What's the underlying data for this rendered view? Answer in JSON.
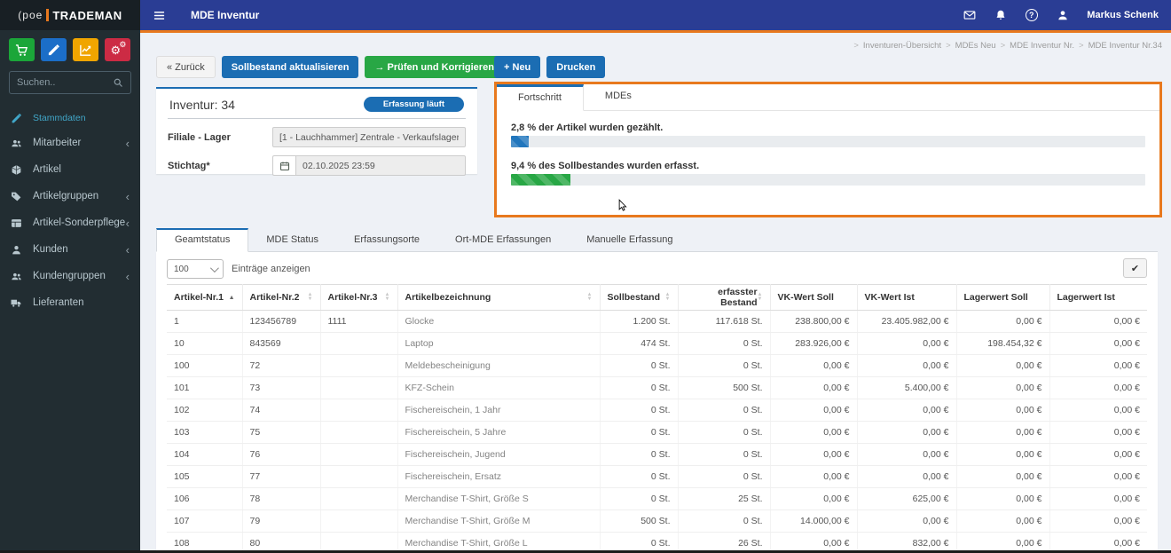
{
  "brand": {
    "mark": "(poe",
    "name": "TRADEMAN"
  },
  "navbar": {
    "title": "MDE Inventur",
    "user": "Markus Schenk"
  },
  "breadcrumb": [
    "Inventuren-Übersicht",
    "MDEs Neu",
    "MDE Inventur Nr.",
    "MDE Inventur Nr.34"
  ],
  "sidebar": {
    "search_placeholder": "Suchen..",
    "quick_buttons": [
      {
        "icon": "cart-icon",
        "color": "#1ba639"
      },
      {
        "icon": "pencil-icon",
        "color": "#1b6ec8"
      },
      {
        "icon": "chart-icon",
        "color": "#f0a500"
      },
      {
        "icon": "cogs-icon",
        "color": "#cc2b44"
      }
    ],
    "items": [
      {
        "label": "Stammdaten",
        "icon": "pencil-icon",
        "active": true,
        "small": true,
        "chevron": false
      },
      {
        "label": "Mitarbeiter",
        "icon": "users-icon",
        "chevron": true
      },
      {
        "label": "Artikel",
        "icon": "product-icon",
        "chevron": false
      },
      {
        "label": "Artikelgruppen",
        "icon": "tags-icon",
        "chevron": true
      },
      {
        "label": "Artikel-Sonderpflege",
        "icon": "table-icon",
        "chevron": true
      },
      {
        "label": "Kunden",
        "icon": "user-icon",
        "chevron": true
      },
      {
        "label": "Kundengruppen",
        "icon": "users-icon",
        "chevron": true
      },
      {
        "label": "Lieferanten",
        "icon": "truck-icon",
        "chevron": false
      }
    ]
  },
  "actions": {
    "back": "« Zurück",
    "update": "Sollbestand aktualisieren",
    "check_arrow": "→",
    "check": "Prüfen und Korrigieren",
    "new_plus": "+",
    "new": "Neu",
    "print": "Drucken"
  },
  "inventory": {
    "title": "Inventur: 34",
    "status": "Erfassung läuft",
    "fields": [
      {
        "label": "Filiale - Lager",
        "value": "[1 - Lauchhammer] Zentrale - Verkaufslager"
      },
      {
        "label": "Stichtag*",
        "value": "02.10.2025 23:59"
      }
    ]
  },
  "progress_panel": {
    "tabs": [
      {
        "label": "Fortschritt",
        "active": true
      },
      {
        "label": "MDEs",
        "active": false
      }
    ],
    "bars": [
      {
        "label": "2,8 % der Artikel wurden gezählt.",
        "percent": 2.8,
        "color": "#2176bd"
      },
      {
        "label": "9,4 % des Sollbestandes wurden erfasst.",
        "percent": 9.4,
        "color": "#28a745"
      }
    ]
  },
  "table_section": {
    "tabs": [
      {
        "label": "Geamtstatus",
        "active": true
      },
      {
        "label": "MDE Status",
        "active": false
      },
      {
        "label": "Erfassungsorte",
        "active": false
      },
      {
        "label": "Ort-MDE Erfassungen",
        "active": false
      },
      {
        "label": "Manuelle Erfassung",
        "active": false
      }
    ],
    "page_size": "100",
    "entries_label": "Einträge anzeigen",
    "check_glyph": "✔"
  },
  "table": {
    "headers": [
      {
        "label": "Artikel-Nr.1",
        "sort": "asc"
      },
      {
        "label": "Artikel-Nr.2",
        "sort": "both"
      },
      {
        "label": "Artikel-Nr.3",
        "sort": "both"
      },
      {
        "label": "Artikelbezeichnung",
        "sort": "both"
      },
      {
        "label": "Sollbestand",
        "sort": "both"
      },
      {
        "label": "erfasster Bestand",
        "sort": "both"
      },
      {
        "label": "VK-Wert Soll",
        "sort": "none"
      },
      {
        "label": "VK-Wert Ist",
        "sort": "none"
      },
      {
        "label": "Lagerwert Soll",
        "sort": "none"
      },
      {
        "label": "Lagerwert Ist",
        "sort": "none"
      }
    ],
    "rows": [
      [
        "1",
        "123456789",
        "1111",
        "Glocke",
        "1.200 St.",
        "117.618 St.",
        "238.800,00 €",
        "23.405.982,00 €",
        "0,00 €",
        "0,00 €"
      ],
      [
        "10",
        "843569",
        "",
        "Laptop",
        "474 St.",
        "0 St.",
        "283.926,00 €",
        "0,00 €",
        "198.454,32 €",
        "0,00 €"
      ],
      [
        "100",
        "72",
        "",
        "Meldebescheinigung",
        "0 St.",
        "0 St.",
        "0,00 €",
        "0,00 €",
        "0,00 €",
        "0,00 €"
      ],
      [
        "101",
        "73",
        "",
        "KFZ-Schein",
        "0 St.",
        "500 St.",
        "0,00 €",
        "5.400,00 €",
        "0,00 €",
        "0,00 €"
      ],
      [
        "102",
        "74",
        "",
        "Fischereischein, 1 Jahr",
        "0 St.",
        "0 St.",
        "0,00 €",
        "0,00 €",
        "0,00 €",
        "0,00 €"
      ],
      [
        "103",
        "75",
        "",
        "Fischereischein, 5 Jahre",
        "0 St.",
        "0 St.",
        "0,00 €",
        "0,00 €",
        "0,00 €",
        "0,00 €"
      ],
      [
        "104",
        "76",
        "",
        "Fischereischein, Jugend",
        "0 St.",
        "0 St.",
        "0,00 €",
        "0,00 €",
        "0,00 €",
        "0,00 €"
      ],
      [
        "105",
        "77",
        "",
        "Fischereischein, Ersatz",
        "0 St.",
        "0 St.",
        "0,00 €",
        "0,00 €",
        "0,00 €",
        "0,00 €"
      ],
      [
        "106",
        "78",
        "",
        "Merchandise T-Shirt, Größe S",
        "0 St.",
        "25 St.",
        "0,00 €",
        "625,00 €",
        "0,00 €",
        "0,00 €"
      ],
      [
        "107",
        "79",
        "",
        "Merchandise T-Shirt, Größe M",
        "500 St.",
        "0 St.",
        "14.000,00 €",
        "0,00 €",
        "0,00 €",
        "0,00 €"
      ],
      [
        "108",
        "80",
        "",
        "Merchandise T-Shirt, Größe L",
        "0 St.",
        "26 St.",
        "0,00 €",
        "832,00 €",
        "0,00 €",
        "0,00 €"
      ]
    ]
  },
  "colors": {
    "navbar_blue": "#2a3d94",
    "accent_orange": "#e8791e",
    "primary_blue": "#1b6db3",
    "success_green": "#28a745",
    "sidebar_bg": "#222d32",
    "page_bg": "#eef1f6",
    "progress_blue": "#2176bd"
  }
}
